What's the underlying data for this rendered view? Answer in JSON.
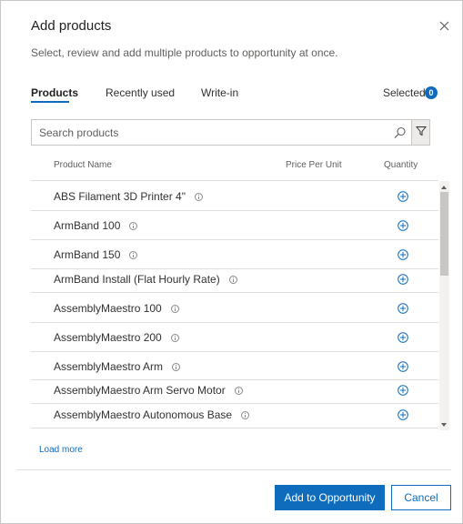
{
  "dialog": {
    "title": "Add products",
    "subtitle": "Select, review and add multiple products to opportunity at once."
  },
  "tabs": [
    {
      "label": "Products",
      "active": true
    },
    {
      "label": "Recently used",
      "active": false
    },
    {
      "label": "Write-in",
      "active": false
    }
  ],
  "selected": {
    "label": "Selected",
    "count": "0"
  },
  "search": {
    "placeholder": "Search products",
    "value": ""
  },
  "columns": {
    "name": "Product Name",
    "price": "Price Per Unit",
    "quantity": "Quantity"
  },
  "products": [
    {
      "name": "ABS Filament 3D Printer 4\""
    },
    {
      "name": "ArmBand 100"
    },
    {
      "name": "ArmBand 150"
    },
    {
      "name": "ArmBand Install (Flat Hourly Rate)"
    },
    {
      "name": "AssemblyMaestro 100"
    },
    {
      "name": "AssemblyMaestro 200"
    },
    {
      "name": "AssemblyMaestro Arm"
    },
    {
      "name": "AssemblyMaestro Arm Servo Motor"
    },
    {
      "name": "AssemblyMaestro Autonomous Base"
    }
  ],
  "load_more": "Load more",
  "footer": {
    "primary": "Add to Opportunity",
    "secondary": "Cancel"
  },
  "colors": {
    "accent": "#0f6cbd",
    "border": "#c8c6c4",
    "text": "#323130"
  },
  "icons": {
    "close": "close-icon",
    "search": "search-icon",
    "filter": "filter-icon",
    "info": "info-icon",
    "add": "add-circle-icon"
  }
}
